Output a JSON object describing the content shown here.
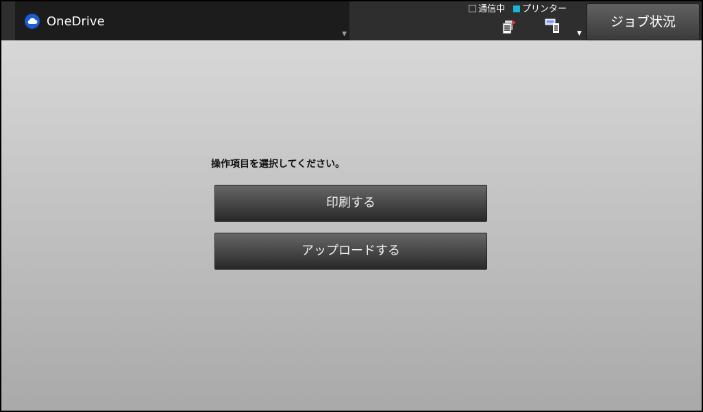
{
  "header": {
    "app_title": "OneDrive",
    "app_icon": "cloud-icon",
    "status_legend": {
      "communicating_label": "通信中",
      "printer_label": "プリンター",
      "printer_color": "#19b5d6"
    },
    "job_status_label": "ジョブ状況"
  },
  "main": {
    "prompt": "操作項目を選択してください。",
    "buttons": {
      "print_label": "印刷する",
      "upload_label": "アップロードする"
    }
  }
}
